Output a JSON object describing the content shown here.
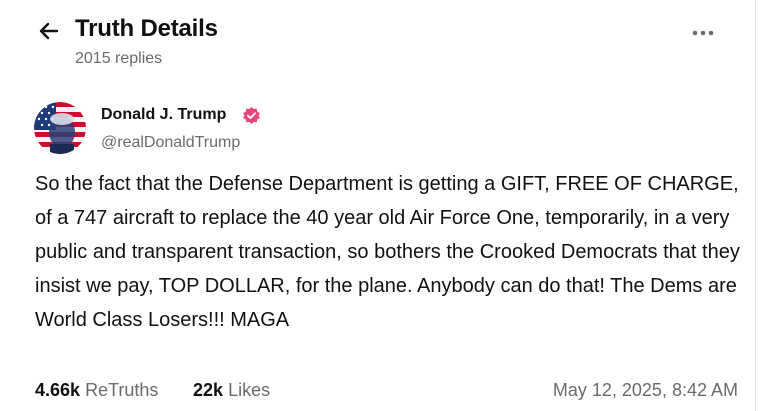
{
  "header": {
    "title": "Truth Details",
    "reply_count": "2015 replies",
    "back_icon": "arrow-left-icon",
    "more_icon": "more-horizontal-icon"
  },
  "author": {
    "name": "Donald J. Trump",
    "handle": "@realDonaldTrump",
    "verified_icon": "verified-check-icon",
    "verified_color": "#e8457a"
  },
  "post": {
    "text": "So the fact that the Defense Department is getting a GIFT, FREE OF CHARGE, of a 747 aircraft to replace the 40 year old Air Force One, temporarily, in a very public and transparent transaction, so bothers the Crooked Democrats that they insist we pay, TOP DOLLAR, for the plane. Anybody can do that! The Dems are World Class Losers!!! MAGA"
  },
  "stats": {
    "retruths_count": "4.66k",
    "retruths_label": "ReTruths",
    "likes_count": "22k",
    "likes_label": "Likes",
    "timestamp": "May 12, 2025, 8:42 AM"
  }
}
